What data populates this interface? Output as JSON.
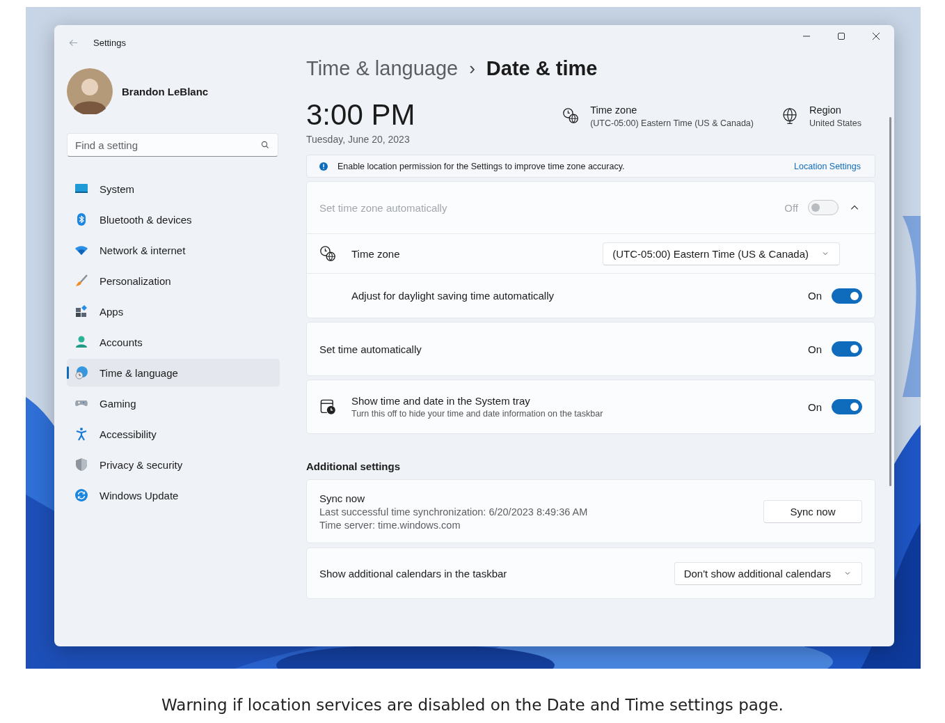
{
  "window": {
    "title": "Settings"
  },
  "user": {
    "name": "Brandon LeBlanc"
  },
  "search": {
    "placeholder": "Find a setting"
  },
  "nav": [
    {
      "label": "System",
      "selected": false
    },
    {
      "label": "Bluetooth & devices",
      "selected": false
    },
    {
      "label": "Network & internet",
      "selected": false
    },
    {
      "label": "Personalization",
      "selected": false
    },
    {
      "label": "Apps",
      "selected": false
    },
    {
      "label": "Accounts",
      "selected": false
    },
    {
      "label": "Time & language",
      "selected": true
    },
    {
      "label": "Gaming",
      "selected": false
    },
    {
      "label": "Accessibility",
      "selected": false
    },
    {
      "label": "Privacy & security",
      "selected": false
    },
    {
      "label": "Windows Update",
      "selected": false
    }
  ],
  "breadcrumb": {
    "parent": "Time & language",
    "separator": "›",
    "current": "Date & time"
  },
  "clock": {
    "time": "3:00 PM",
    "date": "Tuesday, June 20, 2023"
  },
  "summary": [
    {
      "title": "Time zone",
      "value": "(UTC-05:00) Eastern Time (US & Canada)"
    },
    {
      "title": "Region",
      "value": "United States"
    }
  ],
  "notice": {
    "text": "Enable location permission for the Settings to improve time zone accuracy.",
    "link": "Location Settings"
  },
  "groups": [
    {
      "rows": [
        {
          "kind": "toggle",
          "label": "Set time zone automatically",
          "state_text": "Off",
          "on": false,
          "disabled": true,
          "expanded": true
        },
        {
          "kind": "dropdown",
          "label": "Time zone",
          "value": "(UTC-05:00) Eastern Time (US & Canada)"
        },
        {
          "kind": "toggle",
          "label": "Adjust for daylight saving time automatically",
          "state_text": "On",
          "on": true,
          "disabled": false
        }
      ]
    },
    {
      "rows": [
        {
          "kind": "toggle",
          "label": "Set time automatically",
          "state_text": "On",
          "on": true,
          "disabled": false
        }
      ]
    },
    {
      "rows": [
        {
          "kind": "toggle",
          "label": "Show time and date in the System tray",
          "description": "Turn this off to hide your time and date information on the taskbar",
          "state_text": "On",
          "on": true,
          "disabled": false
        }
      ]
    }
  ],
  "additional": {
    "heading": "Additional settings",
    "cards": [
      {
        "kind": "button",
        "label": "Sync now",
        "lines": [
          "Last successful time synchronization: 6/20/2023 8:49:36 AM",
          "Time server: time.windows.com"
        ],
        "button": "Sync now"
      },
      {
        "kind": "dropdown",
        "label": "Show additional calendars in the taskbar",
        "value": "Don't show additional calendars"
      }
    ]
  },
  "caption": "Warning if location services are disabled on the Date and Time settings page."
}
